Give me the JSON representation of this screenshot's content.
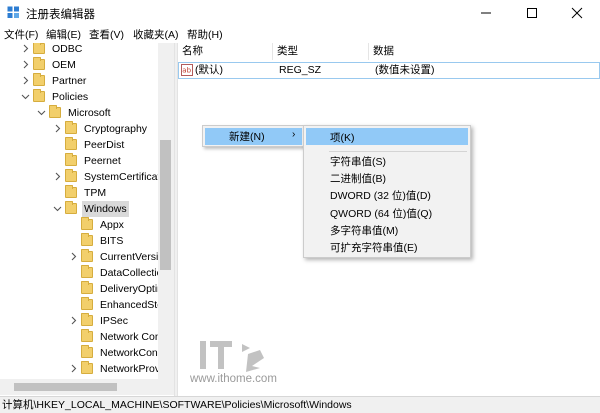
{
  "window": {
    "title": "注册表编辑器"
  },
  "menu": [
    "文件(F)",
    "编辑(E)",
    "查看(V)",
    "收藏夹(A)",
    "帮助(H)"
  ],
  "tree": [
    {
      "label": "ODBC",
      "expander": "collapsed"
    },
    {
      "label": "OEM",
      "expander": "collapsed"
    },
    {
      "label": "Partner",
      "expander": "collapsed"
    },
    {
      "label": "Policies",
      "expander": "expanded"
    },
    {
      "label": "Microsoft",
      "expander": "expanded"
    },
    {
      "label": "Cryptography",
      "expander": "collapsed"
    },
    {
      "label": "PeerDist",
      "expander": "none"
    },
    {
      "label": "Peernet",
      "expander": "none"
    },
    {
      "label": "SystemCertificates",
      "expander": "collapsed"
    },
    {
      "label": "TPM",
      "expander": "none"
    },
    {
      "label": "Windows",
      "expander": "expanded",
      "selected": true
    },
    {
      "label": "Appx",
      "expander": "none"
    },
    {
      "label": "BITS",
      "expander": "none"
    },
    {
      "label": "CurrentVersion",
      "expander": "collapsed"
    },
    {
      "label": "DataCollection",
      "expander": "none"
    },
    {
      "label": "DeliveryOptimization",
      "expander": "none"
    },
    {
      "label": "EnhancedStorage",
      "expander": "none"
    },
    {
      "label": "IPSec",
      "expander": "collapsed"
    },
    {
      "label": "Network Connections",
      "expander": "none"
    },
    {
      "label": "NetworkConnectivity",
      "expander": "none"
    },
    {
      "label": "NetworkProvider",
      "expander": "collapsed"
    }
  ],
  "list": {
    "columns": [
      "名称",
      "类型",
      "数据"
    ],
    "rows": [
      {
        "icon": "ab",
        "name": "(默认)",
        "type": "REG_SZ",
        "data": "(数值未设置)"
      }
    ]
  },
  "context_menu": {
    "label": "新建(N)",
    "arrow": "›"
  },
  "submenu": {
    "items": [
      "项(K)",
      "字符串值(S)",
      "二进制值(B)",
      "DWORD (32 位)值(D)",
      "QWORD (64 位)值(Q)",
      "多字符串值(M)",
      "可扩充字符串值(E)"
    ]
  },
  "watermark": {
    "text": "www.ithome.com"
  },
  "status": {
    "path": "计算机\\HKEY_LOCAL_MACHINE\\SOFTWARE\\Policies\\Microsoft\\Windows"
  },
  "colors": {
    "selection": "#91c9f7",
    "folder": "#f2cf6b",
    "accent": "#0078d7"
  }
}
